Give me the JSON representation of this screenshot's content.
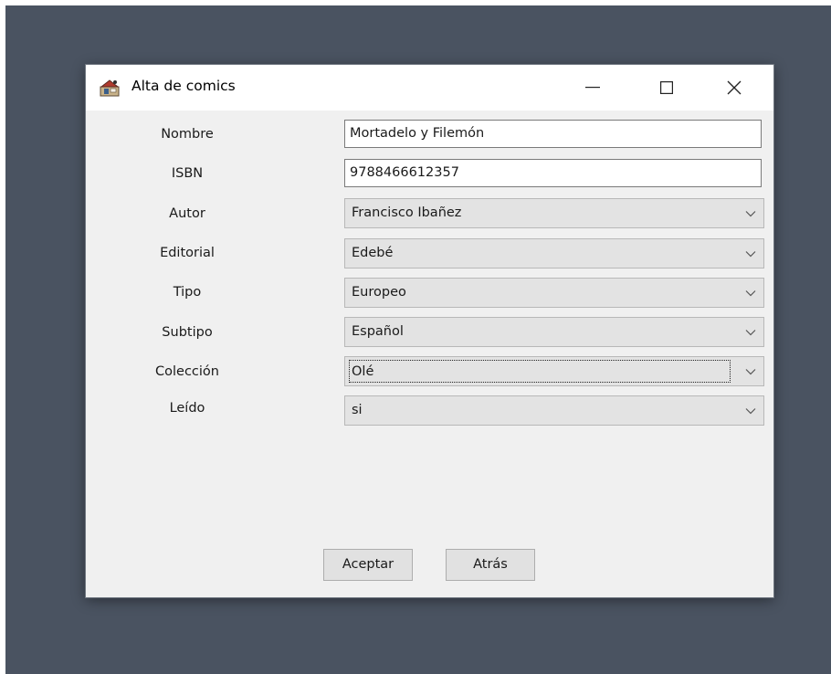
{
  "window": {
    "title": "Alta de comics"
  },
  "controls": {
    "minimize_icon": "minimize-icon",
    "maximize_icon": "maximize-icon",
    "close_icon": "close-icon"
  },
  "form": {
    "fields": [
      {
        "label": "Nombre",
        "value": "Mortadelo y Filemón",
        "type": "text"
      },
      {
        "label": "ISBN",
        "value": "9788466612357",
        "type": "text"
      },
      {
        "label": "Autor",
        "value": "Francisco Ibañez",
        "type": "combo"
      },
      {
        "label": "Editorial",
        "value": "Edebé",
        "type": "combo"
      },
      {
        "label": "Tipo",
        "value": "Europeo",
        "type": "combo"
      },
      {
        "label": "Subtipo",
        "value": "Español",
        "type": "combo"
      },
      {
        "label": "Colección",
        "value": "Olé",
        "type": "combo",
        "focused": true
      },
      {
        "label": "Leído",
        "value": "si",
        "type": "combo"
      }
    ]
  },
  "buttons": {
    "accept": "Aceptar",
    "back": "Atrás"
  },
  "colors": {
    "desktop": "#4a5361",
    "window_body": "#f0f0f0",
    "titlebar": "#ffffff",
    "combo_background": "#e3e3e3",
    "button_background": "#e1e1e1"
  }
}
